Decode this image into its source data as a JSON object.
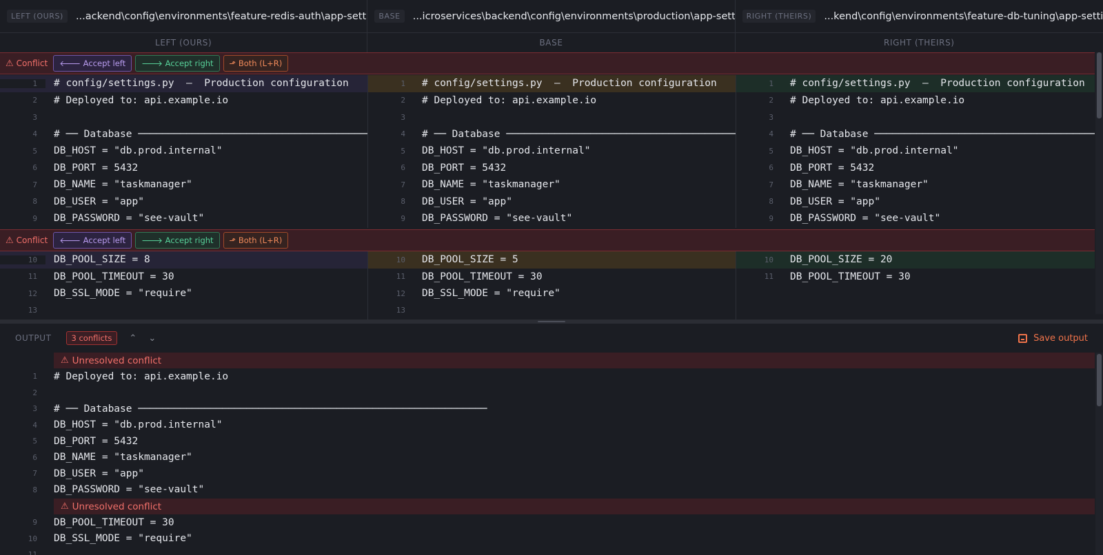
{
  "paths": [
    {
      "tag": "LEFT (OURS)",
      "path": "...ackend\\config\\environments\\feature-redis-auth\\app-settings.py"
    },
    {
      "tag": "BASE",
      "path": "...icroservices\\backend\\config\\environments\\production\\app-settings.py"
    },
    {
      "tag": "RIGHT (THEIRS)",
      "path": "...kend\\config\\environments\\feature-db-tuning\\app-settings.py"
    }
  ],
  "columns": [
    "LEFT (OURS)",
    "BASE",
    "RIGHT (THEIRS)"
  ],
  "conflict_bar": {
    "label": "Conflict",
    "accept_left": "🡐 Accept left",
    "accept_right": "🡒 Accept right",
    "both": "⬏ Both (L+R)"
  },
  "left_lines": [
    {
      "n": "1",
      "t": "# config/settings.py  –  Production configuration"
    },
    {
      "n": "2",
      "t": "# Deployed to: api.example.io"
    },
    {
      "n": "3",
      "t": ""
    },
    {
      "n": "4",
      "t": "# ── Database ────────────────────────────────────────────"
    },
    {
      "n": "5",
      "t": "DB_HOST = \"db.prod.internal\""
    },
    {
      "n": "6",
      "t": "DB_PORT = 5432"
    },
    {
      "n": "7",
      "t": "DB_NAME = \"taskmanager\""
    },
    {
      "n": "8",
      "t": "DB_USER = \"app\""
    },
    {
      "n": "9",
      "t": "DB_PASSWORD = \"see-vault\""
    },
    {
      "n": "10",
      "t": "DB_POOL_SIZE = 8"
    },
    {
      "n": "11",
      "t": "DB_POOL_TIMEOUT = 30"
    },
    {
      "n": "12",
      "t": "DB_SSL_MODE = \"require\""
    },
    {
      "n": "13",
      "t": ""
    }
  ],
  "base_lines": [
    {
      "n": "1",
      "t": "# config/settings.py  –  Production configuration"
    },
    {
      "n": "2",
      "t": "# Deployed to: api.example.io"
    },
    {
      "n": "3",
      "t": ""
    },
    {
      "n": "4",
      "t": "# ── Database ────────────────────────────────────────────"
    },
    {
      "n": "5",
      "t": "DB_HOST = \"db.prod.internal\""
    },
    {
      "n": "6",
      "t": "DB_PORT = 5432"
    },
    {
      "n": "7",
      "t": "DB_NAME = \"taskmanager\""
    },
    {
      "n": "8",
      "t": "DB_USER = \"app\""
    },
    {
      "n": "9",
      "t": "DB_PASSWORD = \"see-vault\""
    },
    {
      "n": "10",
      "t": "DB_POOL_SIZE = 5"
    },
    {
      "n": "11",
      "t": "DB_POOL_TIMEOUT = 30"
    },
    {
      "n": "12",
      "t": "DB_SSL_MODE = \"require\""
    },
    {
      "n": "13",
      "t": ""
    }
  ],
  "right_lines": [
    {
      "n": "1",
      "t": "# config/settings.py  –  Production configuration"
    },
    {
      "n": "2",
      "t": "# Deployed to: api.example.io"
    },
    {
      "n": "3",
      "t": ""
    },
    {
      "n": "4",
      "t": "# ── Database ────────────────────────────────────────────"
    },
    {
      "n": "5",
      "t": "DB_HOST = \"db.prod.internal\""
    },
    {
      "n": "6",
      "t": "DB_PORT = 5432"
    },
    {
      "n": "7",
      "t": "DB_NAME = \"taskmanager\""
    },
    {
      "n": "8",
      "t": "DB_USER = \"app\""
    },
    {
      "n": "9",
      "t": "DB_PASSWORD = \"see-vault\""
    },
    {
      "n": "10",
      "t": "DB_POOL_SIZE = 20"
    },
    {
      "n": "11",
      "t": "DB_POOL_TIMEOUT = 30"
    }
  ],
  "output": {
    "label": "OUTPUT",
    "conflict_count": "3 conflicts",
    "save_label": "Save output",
    "unresolved_label": "Unresolved conflict",
    "lines": [
      {
        "n": "1",
        "t": "# Deployed to: api.example.io"
      },
      {
        "n": "2",
        "t": ""
      },
      {
        "n": "3",
        "t": "# ── Database ──────────────────────────────────────────────────────────"
      },
      {
        "n": "4",
        "t": "DB_HOST = \"db.prod.internal\""
      },
      {
        "n": "5",
        "t": "DB_PORT = 5432"
      },
      {
        "n": "6",
        "t": "DB_NAME = \"taskmanager\""
      },
      {
        "n": "7",
        "t": "DB_USER = \"app\""
      },
      {
        "n": "8",
        "t": "DB_PASSWORD = \"see-vault\""
      },
      {
        "n": "9",
        "t": "DB_POOL_TIMEOUT = 30"
      },
      {
        "n": "10",
        "t": "DB_SSL_MODE = \"require\""
      },
      {
        "n": "11",
        "t": ""
      }
    ]
  },
  "colors": {
    "conflict": "#f2706a",
    "ours": "#b99cf0",
    "theirs": "#58d29a",
    "both": "#f08a5a",
    "save": "#f0734a"
  }
}
